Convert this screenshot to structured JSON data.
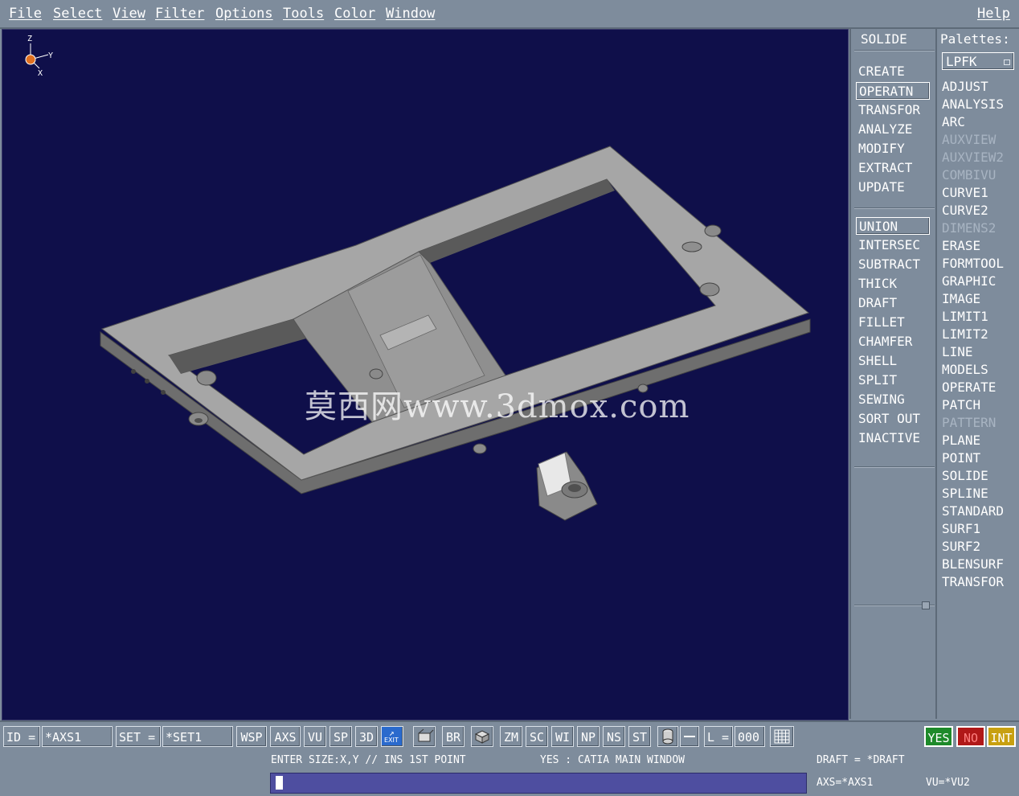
{
  "menubar": {
    "items": [
      "File",
      "Select",
      "View",
      "Filter",
      "Options",
      "Tools",
      "Color",
      "Window"
    ],
    "help": "Help"
  },
  "viewport": {
    "axis_labels": {
      "z": "Z",
      "y": "Y",
      "x": "X"
    },
    "watermark": "莫西网www.3dmox.com"
  },
  "command_panel": {
    "title": "SOLIDE",
    "group1": [
      "CREATE",
      "OPERATN",
      "TRANSFOR",
      "ANALYZE",
      "MODIFY",
      "EXTRACT",
      "UPDATE"
    ],
    "group1_selected": "OPERATN",
    "group2": [
      "UNION",
      "INTERSEC",
      "SUBTRACT",
      "THICK",
      "DRAFT",
      "FILLET",
      "CHAMFER",
      "SHELL",
      "SPLIT",
      "SEWING",
      "SORT OUT",
      "INACTIVE"
    ],
    "group2_selected": "UNION"
  },
  "palettes": {
    "title": "Palettes:",
    "selected": "LPFK",
    "items": [
      {
        "label": "ADJUST",
        "enabled": true
      },
      {
        "label": "ANALYSIS",
        "enabled": true
      },
      {
        "label": "ARC",
        "enabled": true
      },
      {
        "label": "AUXVIEW",
        "enabled": false
      },
      {
        "label": "AUXVIEW2",
        "enabled": false
      },
      {
        "label": "COMBIVU",
        "enabled": false
      },
      {
        "label": "CURVE1",
        "enabled": true
      },
      {
        "label": "CURVE2",
        "enabled": true
      },
      {
        "label": "DIMENS2",
        "enabled": false
      },
      {
        "label": "ERASE",
        "enabled": true
      },
      {
        "label": "FORMTOOL",
        "enabled": true
      },
      {
        "label": "GRAPHIC",
        "enabled": true
      },
      {
        "label": "IMAGE",
        "enabled": true
      },
      {
        "label": "LIMIT1",
        "enabled": true
      },
      {
        "label": "LIMIT2",
        "enabled": true
      },
      {
        "label": "LINE",
        "enabled": true
      },
      {
        "label": "MODELS",
        "enabled": true
      },
      {
        "label": "OPERATE",
        "enabled": true
      },
      {
        "label": "PATCH",
        "enabled": true
      },
      {
        "label": "PATTERN",
        "enabled": false
      },
      {
        "label": "PLANE",
        "enabled": true
      },
      {
        "label": "POINT",
        "enabled": true
      },
      {
        "label": "SOLIDE",
        "enabled": true
      },
      {
        "label": "SPLINE",
        "enabled": true
      },
      {
        "label": "STANDARD",
        "enabled": true
      },
      {
        "label": "SURF1",
        "enabled": true
      },
      {
        "label": "SURF2",
        "enabled": true
      },
      {
        "label": "BLENSURF",
        "enabled": true
      },
      {
        "label": "TRANSFOR",
        "enabled": true
      }
    ]
  },
  "toolbar": {
    "id_label": "ID =",
    "id_value": "*AXS1",
    "set_label": "SET =",
    "set_value": "*SET1",
    "buttons1": [
      "WSP",
      "AXS",
      "VU",
      "SP",
      "3D"
    ],
    "exit_label": "EXIT",
    "br": "BR",
    "buttons2": [
      "ZM",
      "SC",
      "WI",
      "NP",
      "NS",
      "ST"
    ],
    "layer_label": "L =",
    "layer_value": "000",
    "yes": "YES",
    "no": "NO",
    "int": "INT",
    "colors": {
      "yes": "#1e8a2a",
      "no": "#b01818",
      "int": "#c8a010"
    }
  },
  "status": {
    "prompt": "ENTER SIZE:X,Y // INS 1ST POINT",
    "window": "YES : CATIA MAIN WINDOW",
    "draft": "DRAFT = *DRAFT",
    "axs": "AXS=*AXS1",
    "vu": "VU=*VU2",
    "input_value": ""
  }
}
